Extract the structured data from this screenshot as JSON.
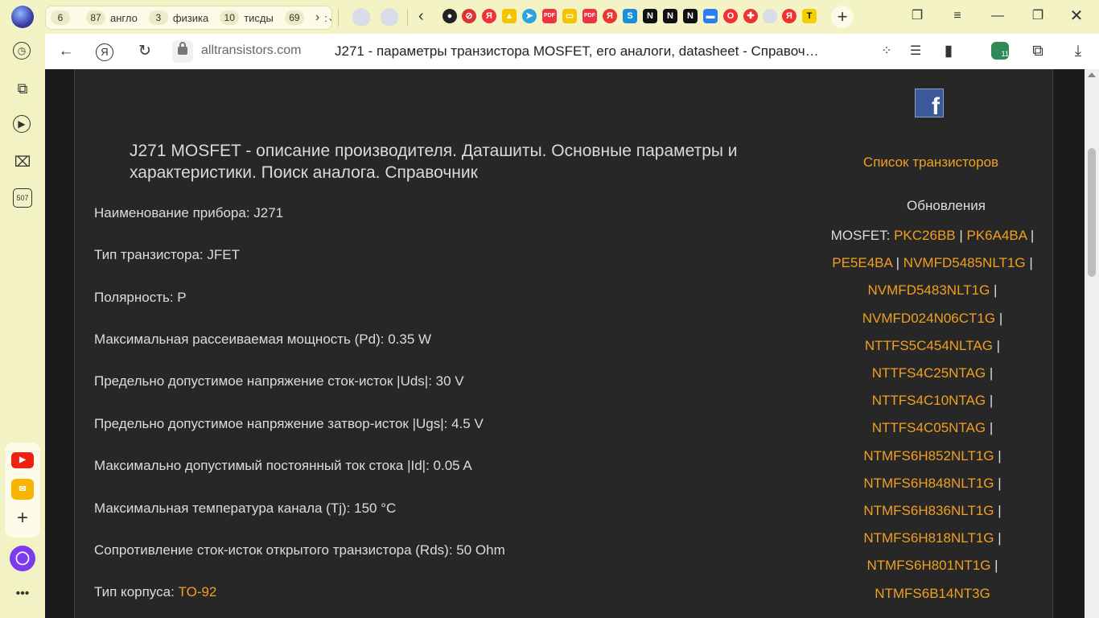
{
  "tab_groups": [
    {
      "count": "6",
      "label": ""
    },
    {
      "count": "87",
      "label": "англо"
    },
    {
      "count": "3",
      "label": "физика"
    },
    {
      "count": "10",
      "label": "тисды"
    },
    {
      "count": "69",
      "label": ""
    }
  ],
  "tab_groups_more": ":",
  "address": {
    "host": "alltransistors.com",
    "title": "J271 - параметры транзистора MOSFET, его аналоги, datasheet - Справоч…"
  },
  "sidebar": {
    "badge": "507"
  },
  "toolbar": {
    "ext_badge": "11"
  },
  "main": {
    "heading": "J271 MOSFET - описание производителя. Даташиты. Основные параметры и характеристики. Поиск аналога. Справочник",
    "params": [
      {
        "label": "Наименование прибора: J271",
        "value": ""
      },
      {
        "label": "Тип транзистора: JFET",
        "value": ""
      },
      {
        "label": "Полярность: P",
        "value": ""
      },
      {
        "label": "Максимальная рассеиваемая мощность (Pd): 0.35 W",
        "value": ""
      },
      {
        "label": "Предельно допустимое напряжение сток-исток |Uds|: 30 V",
        "value": ""
      },
      {
        "label": "Предельно допустимое напряжение затвор-исток |Ugs|: 4.5 V",
        "value": ""
      },
      {
        "label": "Максимально допустимый постоянный ток стока |Id|: 0.05 A",
        "value": ""
      },
      {
        "label": "Максимальная температура канала (Tj): 150 °C",
        "value": ""
      },
      {
        "label": "Сопротивление сток-исток открытого транзистора (Rds): 50 Ohm",
        "value": ""
      },
      {
        "label": "Тип корпуса: ",
        "value": "TO-92"
      }
    ]
  },
  "right": {
    "list_link": "Список транзисторов",
    "updates_title": "Обновления",
    "mosfet_prefix": "MOSFET: ",
    "updates": [
      "PKC26BB",
      "PK6A4BA",
      "PE5E4BA",
      "NVMFD5485NLT1G",
      "NVMFD5483NLT1G",
      "NVMFD024N06CT1G",
      "NTTFS5C454NLTAG",
      "NTTFS4C25NTAG",
      "NTTFS4C10NTAG",
      "NTTFS4C05NTAG",
      "NTMFS6H852NLT1G",
      "NTMFS6H848NLT1G",
      "NTMFS6H836NLT1G",
      "NTMFS6H818NLT1G",
      "NTMFS6H801NT1G",
      "NTMFS6B14NT3G"
    ]
  },
  "colors": {
    "link": "#f0a020",
    "page_bg": "#272727",
    "chrome": "#f3f2c4"
  }
}
